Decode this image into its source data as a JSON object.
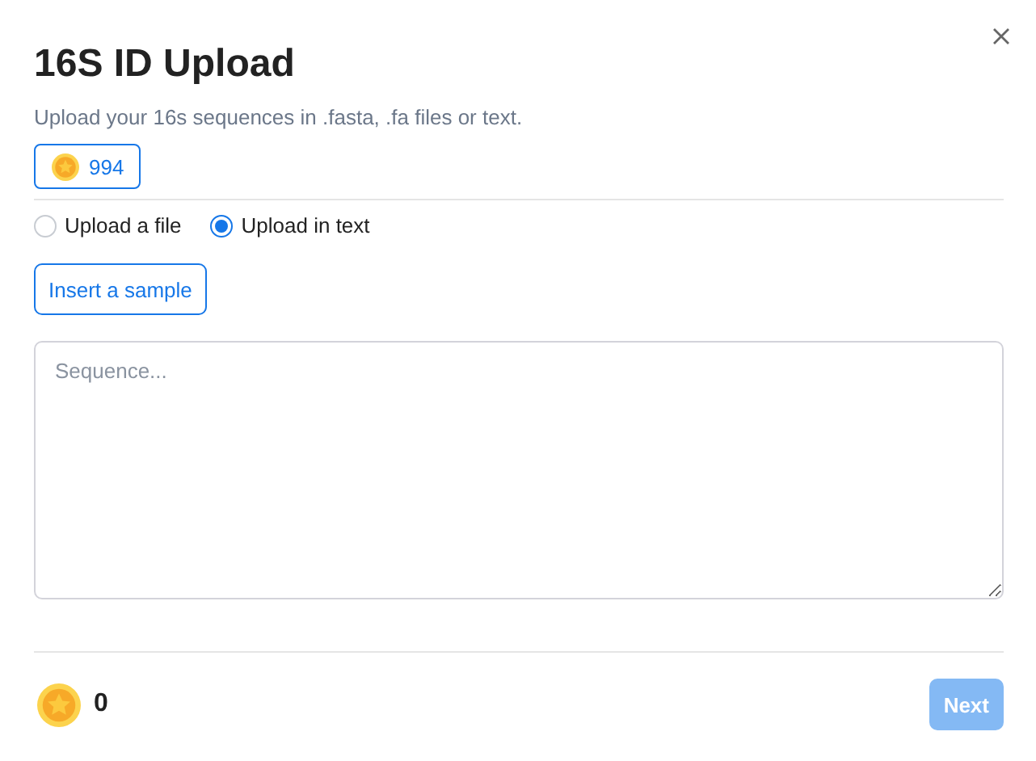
{
  "dialog": {
    "title": "16S ID Upload",
    "subtitle": "Upload your 16s sequences in .fasta, .fa files or text."
  },
  "balance_badge": {
    "value": "994"
  },
  "upload_modes": [
    {
      "label": "Upload a file",
      "selected": false
    },
    {
      "label": "Upload in text",
      "selected": true
    }
  ],
  "sample_button": {
    "label": "Insert a sample"
  },
  "sequence_field": {
    "placeholder": "Sequence..."
  },
  "footer": {
    "cost": "0",
    "next_button": {
      "label": "Next",
      "disabled": true
    }
  }
}
